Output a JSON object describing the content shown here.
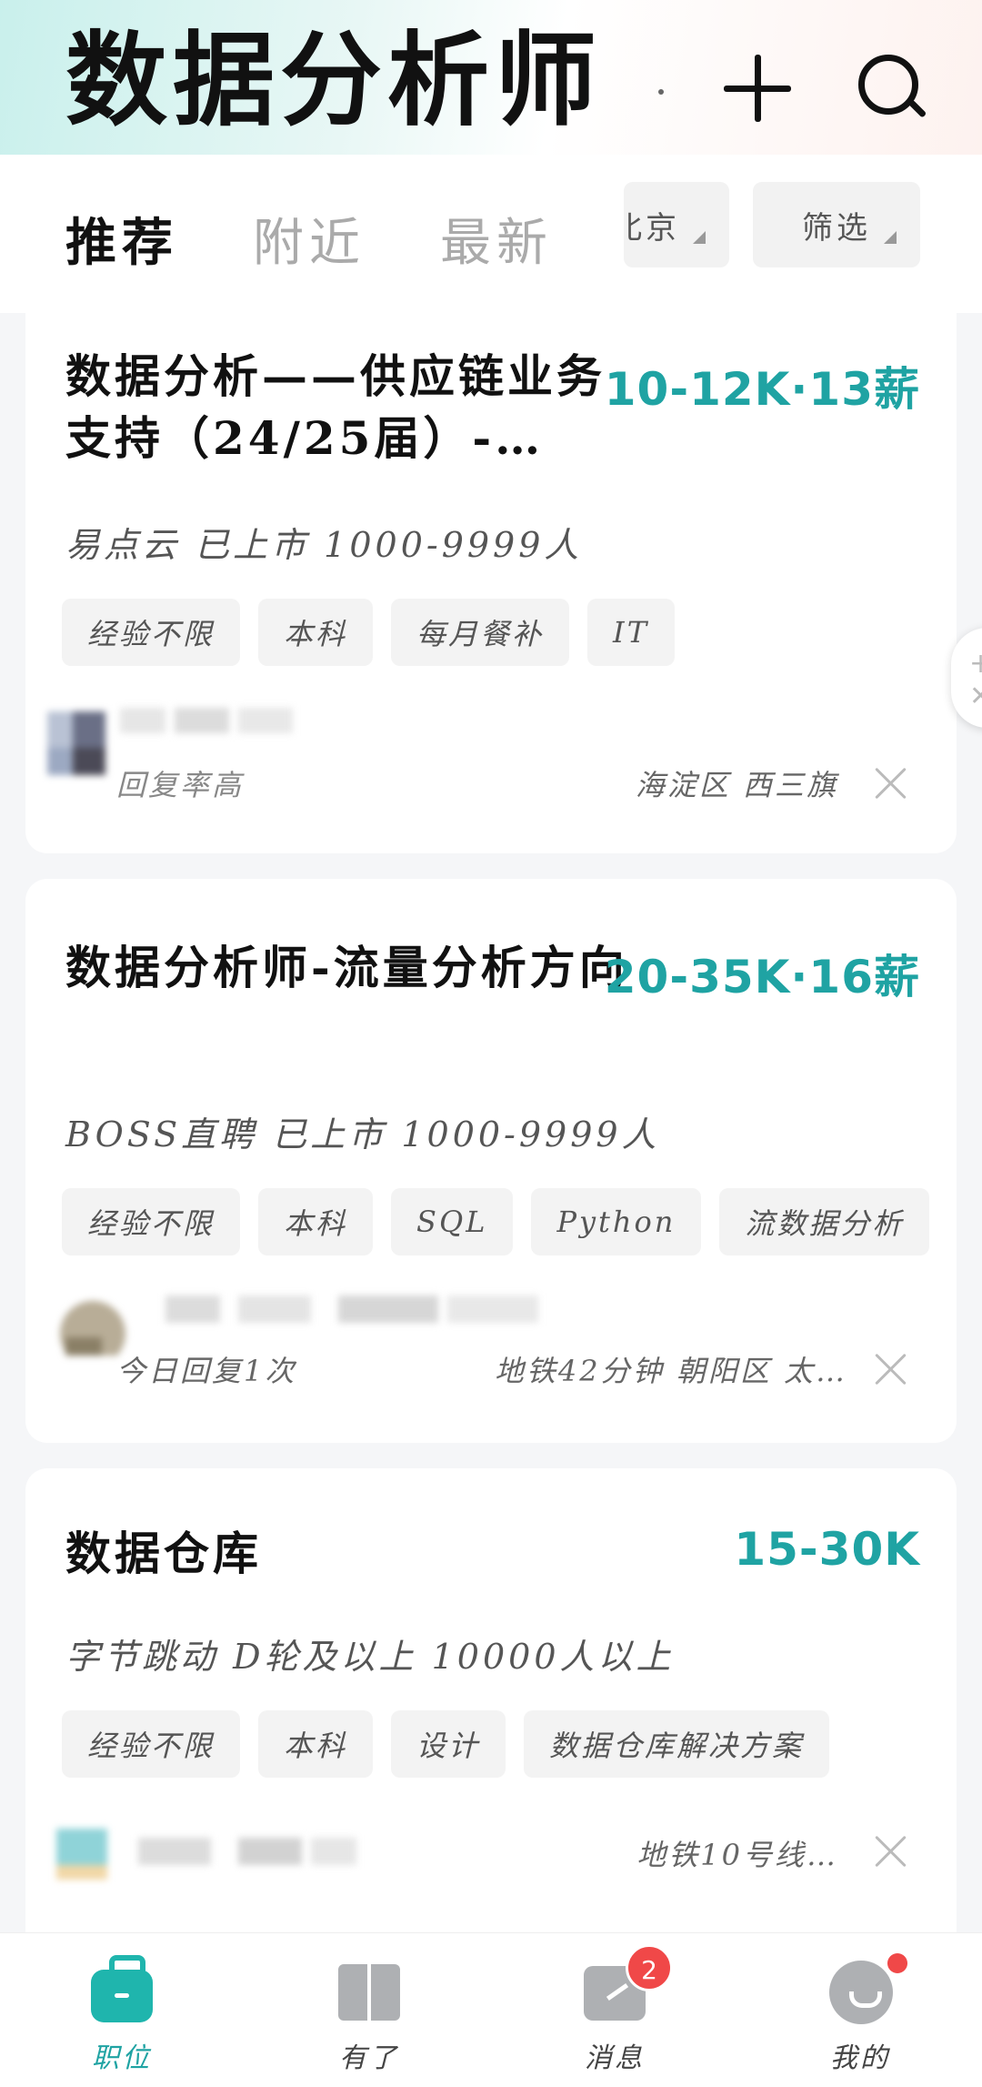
{
  "header": {
    "title": "数据分析师",
    "add_icon": "plus-icon",
    "search_icon": "search-icon"
  },
  "tabs": {
    "items": [
      "推荐",
      "附近",
      "最新"
    ],
    "city_label": "北京",
    "filter_label": "筛选"
  },
  "jobs": [
    {
      "title": "数据分析——供应链业务支持（24/25届）-…",
      "salary": "10-12K·13薪",
      "company_line": "易点云  已上市  1000-9999人",
      "tags": [
        "经验不限",
        "本科",
        "每月餐补",
        "IT"
      ],
      "reply_text": "回复率高",
      "location_text": "海淀区  西三旗"
    },
    {
      "title": "数据分析师-流量分析方向",
      "salary": "20-35K·16薪",
      "company_line": "BOSS直聘  已上市  1000-9999人",
      "tags": [
        "经验不限",
        "本科",
        "SQL",
        "Python",
        "流数据分析"
      ],
      "reply_text": "今日回复1次",
      "location_text": "地铁42分钟  朝阳区  太…"
    },
    {
      "title": "数据仓库",
      "salary": "15-30K",
      "company_line": "字节跳动  D轮及以上  10000人以上",
      "tags": [
        "经验不限",
        "本科",
        "设计",
        "数据仓库解决方案"
      ],
      "reply_text": "",
      "location_text": "地铁10号线…"
    }
  ],
  "bottom_nav": {
    "items": [
      {
        "label": "职位",
        "icon": "briefcase-icon",
        "active": true
      },
      {
        "label": "有了",
        "icon": "book-icon"
      },
      {
        "label": "消息",
        "icon": "chat-icon",
        "badge": "2"
      },
      {
        "label": "我的",
        "icon": "profile-icon"
      }
    ]
  },
  "colors": {
    "accent": "#1fa3a3",
    "badge": "#f04848"
  }
}
